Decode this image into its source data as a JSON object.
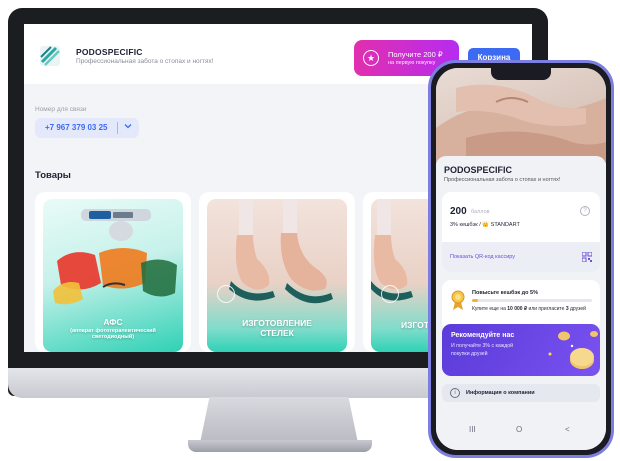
{
  "desktop": {
    "brand": "PODOSPECIFIC",
    "tagline": "Профессиональная забота о стопах и ногтях!",
    "promo": {
      "title": "Получите 200 ₽",
      "subtitle": "на первую покупку"
    },
    "cart_label": "Корзина",
    "contact_label": "Номер для связи",
    "phone": "+7 967 379 03 25",
    "section_title": "Товары",
    "products": [
      {
        "caption_line1": "АФС",
        "caption_line2": "(аппарат фототерапевтический",
        "caption_line3": "светодиодный)"
      },
      {
        "caption_line1": "ИЗГОТОВЛЕНИЕ",
        "caption_line2": "СТЕЛЕК"
      },
      {
        "caption_line1": "ИЗГОТ"
      }
    ]
  },
  "mobile": {
    "brand": "PODOSPECIFIC",
    "tagline": "Профессиональная забота о стопах и ногтях!",
    "balance": "200",
    "balance_label": "баллов",
    "tier": "3% кешбэк / 👑 STANDART",
    "qr_label": "Показать QR-код кассиру",
    "upgrade_title": "Повысьте кешбэк до 5%",
    "upgrade_progress": 0.05,
    "upgrade_desc": {
      "before": "Купите еще на ",
      "amount": "10 000 ₽",
      "middle": " или пригласите ",
      "count": "3",
      "after": " друзей"
    },
    "referral_title": "Рекомендуйте нас",
    "referral_sub": "И получайте 3% с каждой покупки друзей",
    "about_label": "Информация о компании",
    "nav": {
      "menu": "III",
      "home": "O",
      "back": "<"
    }
  },
  "colors": {
    "accent_blue": "#3d6af2",
    "promo_pink": "#e12fae",
    "promo_purple": "#b62cf0",
    "referral_purple": "#5a3bd9",
    "teal": "#2fd1b5",
    "phone_frame": "#7c7fe0"
  }
}
